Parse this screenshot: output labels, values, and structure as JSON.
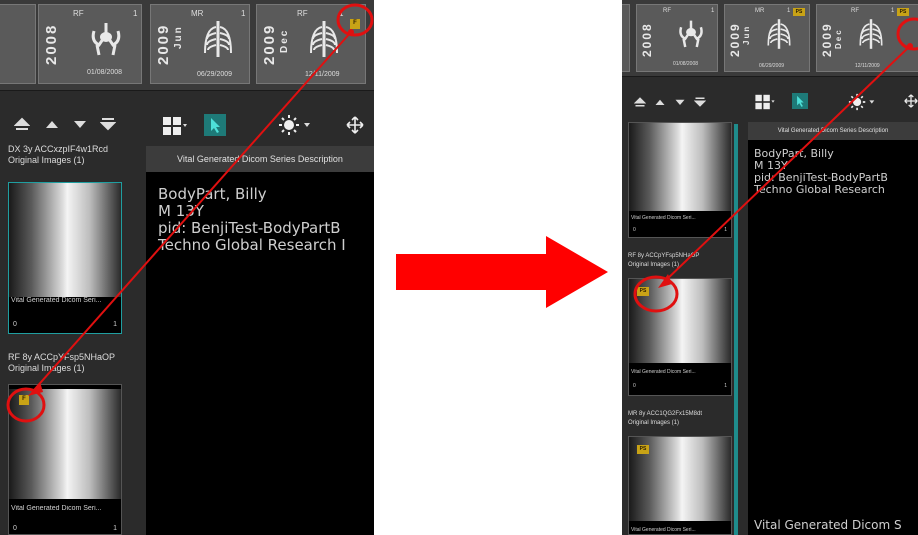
{
  "left": {
    "studies": [
      {
        "year": "2008",
        "month": "",
        "modality": "RF",
        "count": "1",
        "date": "01/08/2008"
      },
      {
        "year": "2009",
        "month": "Jun",
        "modality": "MR",
        "count": "1",
        "date": "06/29/2009"
      },
      {
        "year": "2009",
        "month": "Dec",
        "modality": "RF",
        "count": "1",
        "date": "12/11/2009",
        "flag": "F"
      }
    ],
    "series": [
      {
        "title": "DX 3y ACCxzpIF4w1Rcd",
        "subtitle": "Original Images (1)",
        "caption": "Vital Generated Dicom Seri...",
        "index": "0",
        "count": "1"
      },
      {
        "title": "RF 8y ACCpYFsp5NHaOP",
        "subtitle": "Original Images (1)",
        "caption": "Vital Generated Dicom Seri...",
        "index": "0",
        "count": "1",
        "flag": "F"
      }
    ],
    "viewer": {
      "header": "Vital Generated Dicom Series Description",
      "name": "BodyPart, Billy",
      "sex_age": "M 13Y",
      "pid": "pid: BenjiTest-BodyPartB",
      "institution": "Techno Global Research I"
    }
  },
  "right": {
    "studies": [
      {
        "year": "2008",
        "month": "",
        "modality": "RF",
        "count": "1",
        "date": "01/08/2008"
      },
      {
        "year": "2009",
        "month": "Jun",
        "modality": "MR",
        "count": "1",
        "date": "06/29/2009",
        "flag": "PS"
      },
      {
        "year": "2009",
        "month": "Dec",
        "modality": "RF",
        "count": "1",
        "date": "12/11/2009",
        "flag": "PS"
      }
    ],
    "series": [
      {
        "title": "",
        "subtitle": "",
        "caption": "Vital Generated Dicom Seri...",
        "index": "0",
        "count": "1"
      },
      {
        "title": "RF 8y ACCpYFsp5NHaOP",
        "subtitle": "Original Images (1)",
        "caption": "Vital Generated Dicom Seri...",
        "index": "0",
        "count": "1",
        "flag": "PS"
      },
      {
        "title": "MR 8y ACC1QG2Fx15M8dt",
        "subtitle": "Original Images (1)",
        "caption": "Vital Generated Dicom Seri...",
        "index": "",
        "count": "",
        "flag": "PS"
      }
    ],
    "viewer": {
      "header": "Vital Generated Dicom Series Description",
      "name": "BodyPart, Billy",
      "sex_age": "M 13Y",
      "pid": "pid: BenjiTest-BodyPartB",
      "institution": "Techno Global Research",
      "footer": "Vital Generated Dicom S"
    }
  },
  "colors": {
    "annotation_red": "#e01010",
    "selection_teal": "#1f9ea0",
    "flag_yellow": "#c8a316",
    "panel_dark": "#2b2b2b",
    "viewer_black": "#000000"
  },
  "icons": [
    "chest-xray-icon",
    "pelvis-xray-icon",
    "layout-grid-icon",
    "pointer-icon",
    "brightness-icon",
    "pan-icon",
    "collapse-all-icon",
    "scroll-up-icon",
    "scroll-down-icon",
    "expand-all-icon",
    "forward-arrow-icon"
  ]
}
